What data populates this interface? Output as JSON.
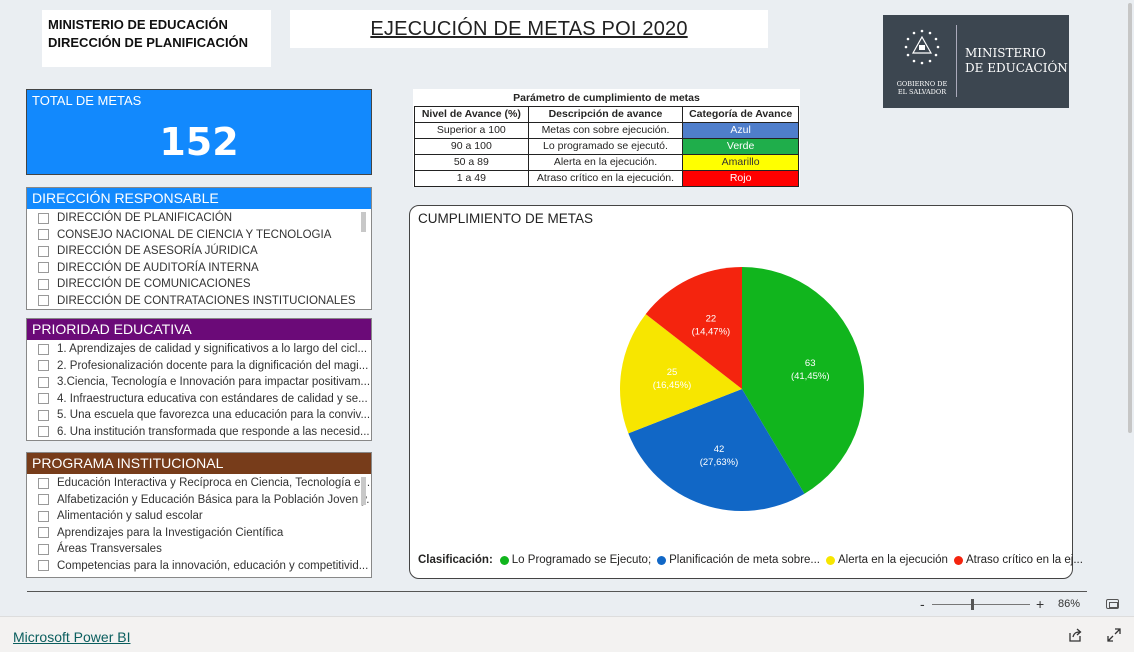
{
  "header": {
    "org_line1": "MINISTERIO DE EDUCACIÓN",
    "org_line2": "DIRECCIÓN DE PLANIFICACIÓN",
    "title": "EJECUCIÓN DE METAS POI 2020",
    "logo_ministry_line1": "MINISTERIO",
    "logo_ministry_line2": "DE EDUCACIÓN",
    "logo_gov_line1": "GOBIERNO DE",
    "logo_gov_line2": "EL SALVADOR"
  },
  "total": {
    "label": "TOTAL DE METAS",
    "value": "152"
  },
  "slicers": {
    "direccion": {
      "title": "DIRECCIÓN RESPONSABLE",
      "color": "#1289fd",
      "items": [
        "DIRECCIÓN DE PLANIFICACIÓN",
        "CONSEJO NACIONAL DE CIENCIA Y TECNOLOGIA",
        "DIRECCIÓN DE ASESORÍA JÚRIDICA",
        "DIRECCIÓN DE AUDITORÍA INTERNA",
        "DIRECCIÓN DE COMUNICACIONES",
        "DIRECCIÓN DE CONTRATACIONES INSTITUCIONALES"
      ]
    },
    "prioridad": {
      "title": "PRIORIDAD EDUCATIVA",
      "color": "#6b0a78",
      "items": [
        "1. Aprendizajes de calidad y significativos a lo largo del cicl...",
        "2. Profesionalización docente para la dignificación del magi...",
        "3.Ciencia, Tecnología e Innovación para impactar positivam...",
        "4. Infraestructura educativa con estándares de calidad y se...",
        "5. Una escuela que favorezca una educación para la conviv...",
        "6. Una institución transformada que responde a las necesid..."
      ]
    },
    "programa": {
      "title": "PROGRAMA INSTITUCIONAL",
      "color": "#773c1a",
      "items": [
        "Educación Interactiva y Recíproca en Ciencia, Tecnología e I...",
        "Alfabetización y Educación Básica para la Población Joven y...",
        "Alimentación y salud escolar",
        "Aprendizajes para la Investigación Científica",
        "Áreas Transversales",
        "Competencias para la innovación, educación y competitivid..."
      ]
    }
  },
  "param_table": {
    "title": "Parámetro de cumplimiento de metas",
    "headers": [
      "Nivel de Avance (%)",
      "Descripción de avance",
      "Categoría de Avance"
    ],
    "rows": [
      {
        "nivel": "Superior a 100",
        "descripcion": "Metas con sobre ejecución.",
        "categoria": "Azul",
        "color": "#4f7ecb"
      },
      {
        "nivel": "90 a 100",
        "descripcion": "Lo programado se ejecutó.",
        "categoria": "Verde",
        "color": "#1fae4b"
      },
      {
        "nivel": "50 a 89",
        "descripcion": "Alerta en la ejecución.",
        "categoria": "Amarillo",
        "color": "#ffff00"
      },
      {
        "nivel": "1 a 49",
        "descripcion": "Atraso crítico en la ejecución.",
        "categoria": "Rojo",
        "color": "#ff0000"
      }
    ]
  },
  "chart_data": {
    "type": "pie",
    "title": "CUMPLIMIENTO DE METAS",
    "legend_title": "Clasificación:",
    "legend_position": "bottom",
    "slices": [
      {
        "name": "Lo Programado se Ejecuto;",
        "value": 63,
        "label": "63",
        "pct": "(41,45%)",
        "color": "#11b51d"
      },
      {
        "name": "Planificación de meta sobre...",
        "value": 42,
        "label": "42",
        "pct": "(27,63%)",
        "color": "#1167c6"
      },
      {
        "name": "Alerta en la ejecución",
        "value": 25,
        "label": "25",
        "pct": "(16,45%)",
        "color": "#f7e600"
      },
      {
        "name": "Atraso crítico en la ej...",
        "value": 22,
        "label": "22",
        "pct": "(14,47%)",
        "color": "#f4240e"
      }
    ]
  },
  "zoom": {
    "minus": "-",
    "plus": "+",
    "value": "86%",
    "level_fraction": 0.41
  },
  "footer": {
    "brand": "Microsoft Power BI"
  }
}
